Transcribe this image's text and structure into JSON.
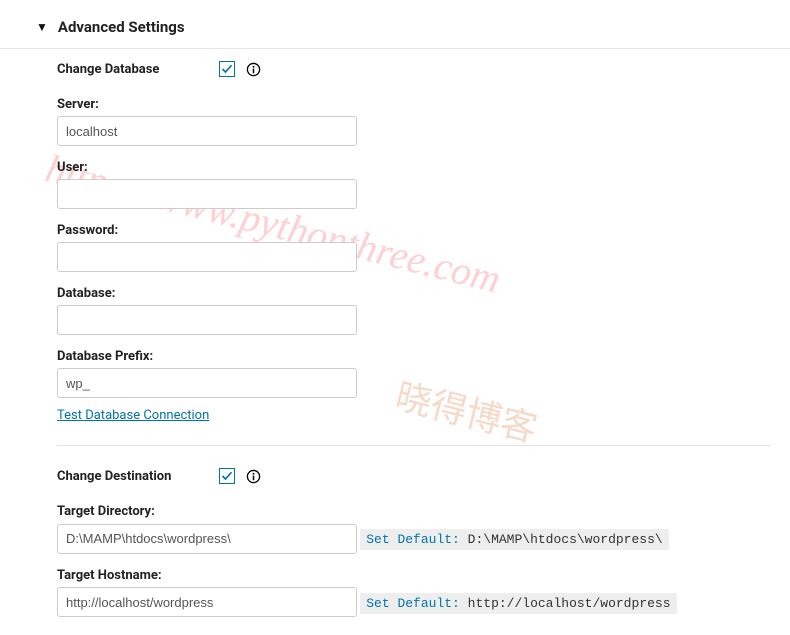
{
  "header": {
    "title": "Advanced Settings"
  },
  "changeDatabase": {
    "label": "Change Database",
    "checked": true,
    "fields": {
      "server": {
        "label": "Server:",
        "value": "localhost"
      },
      "user": {
        "label": "User:",
        "value": ""
      },
      "password": {
        "label": "Password:",
        "value": ""
      },
      "database": {
        "label": "Database:",
        "value": ""
      },
      "prefix": {
        "label": "Database Prefix:",
        "value": "wp_"
      }
    },
    "testLink": "Test Database Connection"
  },
  "changeDestination": {
    "label": "Change Destination",
    "checked": true,
    "fields": {
      "targetDir": {
        "label": "Target Directory:",
        "value": "D:\\MAMP\\htdocs\\wordpress\\",
        "defaultLabel": "Set Default:",
        "defaultValue": " D:\\MAMP\\htdocs\\wordpress\\"
      },
      "targetHost": {
        "label": "Target Hostname:",
        "value": "http://localhost/wordpress",
        "defaultLabel": "Set Default:",
        "defaultValue": " http://localhost/wordpress"
      }
    }
  },
  "watermark": {
    "url": "https://www.pythonthree.com",
    "blog": "晓得博客"
  }
}
